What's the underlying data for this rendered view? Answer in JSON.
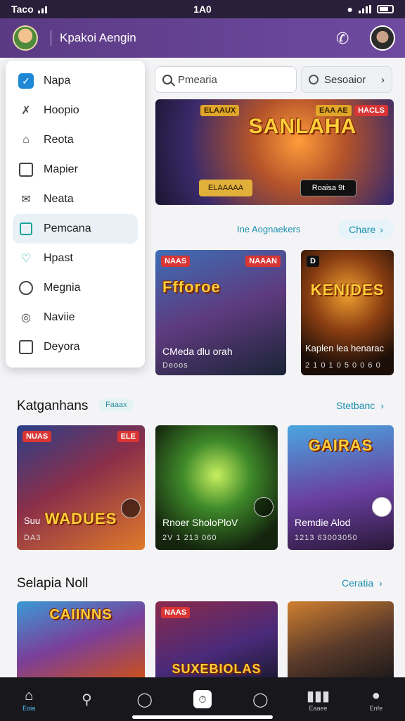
{
  "status": {
    "carrier": "Taco",
    "time": "1A0"
  },
  "appbar": {
    "title": "Kpakoi Aengin"
  },
  "drawer": {
    "items": [
      {
        "label": "Napa",
        "icon": "check-square-icon"
      },
      {
        "label": "Hoopio",
        "icon": "tools-icon"
      },
      {
        "label": "Reota",
        "icon": "home-outline-icon"
      },
      {
        "label": "Mapier",
        "icon": "calendar-icon"
      },
      {
        "label": "Neata",
        "icon": "envelope-icon"
      },
      {
        "label": "Pemcana",
        "icon": "document-icon"
      },
      {
        "label": "Hpast",
        "icon": "heart-icon"
      },
      {
        "label": "Megnia",
        "icon": "clock-icon"
      },
      {
        "label": "Naviie",
        "icon": "target-icon"
      },
      {
        "label": "Deyora",
        "icon": "window-icon"
      }
    ],
    "active_index": 5
  },
  "search": {
    "placeholder": "Pmearia"
  },
  "chip": {
    "label": "Sesoaior"
  },
  "hero": {
    "badge_left": "ELAAUX",
    "badge_mid": "EAA AE",
    "badge_right": "HACLS",
    "logo": "SANLAHA",
    "btn_left": "ELAAAAA",
    "btn_right": "Roaisa 9t"
  },
  "section1": {
    "title": "Ine Aognaekers",
    "action": "Chare"
  },
  "row1": [
    {
      "badge": "NAAS",
      "badge2": "NAAAN",
      "logo": "Ffforoe",
      "caption": "CMeda dlu orah",
      "sub": "Deoos"
    },
    {
      "badge": "D",
      "logo": "KENIDES",
      "caption": "Kaplen lea henarac",
      "sub": "2 1 0 1 0 5 0 0 6 0"
    }
  ],
  "section2": {
    "title": "Katganhans",
    "tag": "Faaax",
    "action": "Stetbanc"
  },
  "row2": [
    {
      "badge": "NUAS",
      "badge2": "ELE",
      "logo": "WADUES",
      "caption": "Suu",
      "sub": "DA3"
    },
    {
      "caption": "Rnoer SholoPloV",
      "sub": "2V 1 213 060"
    },
    {
      "badge": "",
      "logo": "GAIRAS",
      "caption": "Remdie Alod",
      "sub": "1213 63003050"
    }
  ],
  "section3": {
    "title": "Selapia Noll",
    "action": "Ceratia"
  },
  "row3": [
    {
      "logo": "CAIINNS"
    },
    {
      "badge": "NAAS",
      "logo": "SUXEBIOLAS"
    },
    {
      "badge": ""
    }
  ],
  "nav": [
    {
      "label": "Eoia",
      "icon": "home-icon"
    },
    {
      "label": "",
      "icon": "search-icon"
    },
    {
      "label": "",
      "icon": "compass-icon"
    },
    {
      "label": "",
      "icon": "clock-icon"
    },
    {
      "label": "",
      "icon": "activity-icon"
    },
    {
      "label": "Eaaee",
      "icon": "library-icon"
    },
    {
      "label": "Enfe",
      "icon": "person-icon"
    }
  ],
  "colors": {
    "appbar": "#6e4aa0",
    "accent": "#1c8fb0",
    "badge": "#d93535",
    "nav": "#17171c"
  }
}
